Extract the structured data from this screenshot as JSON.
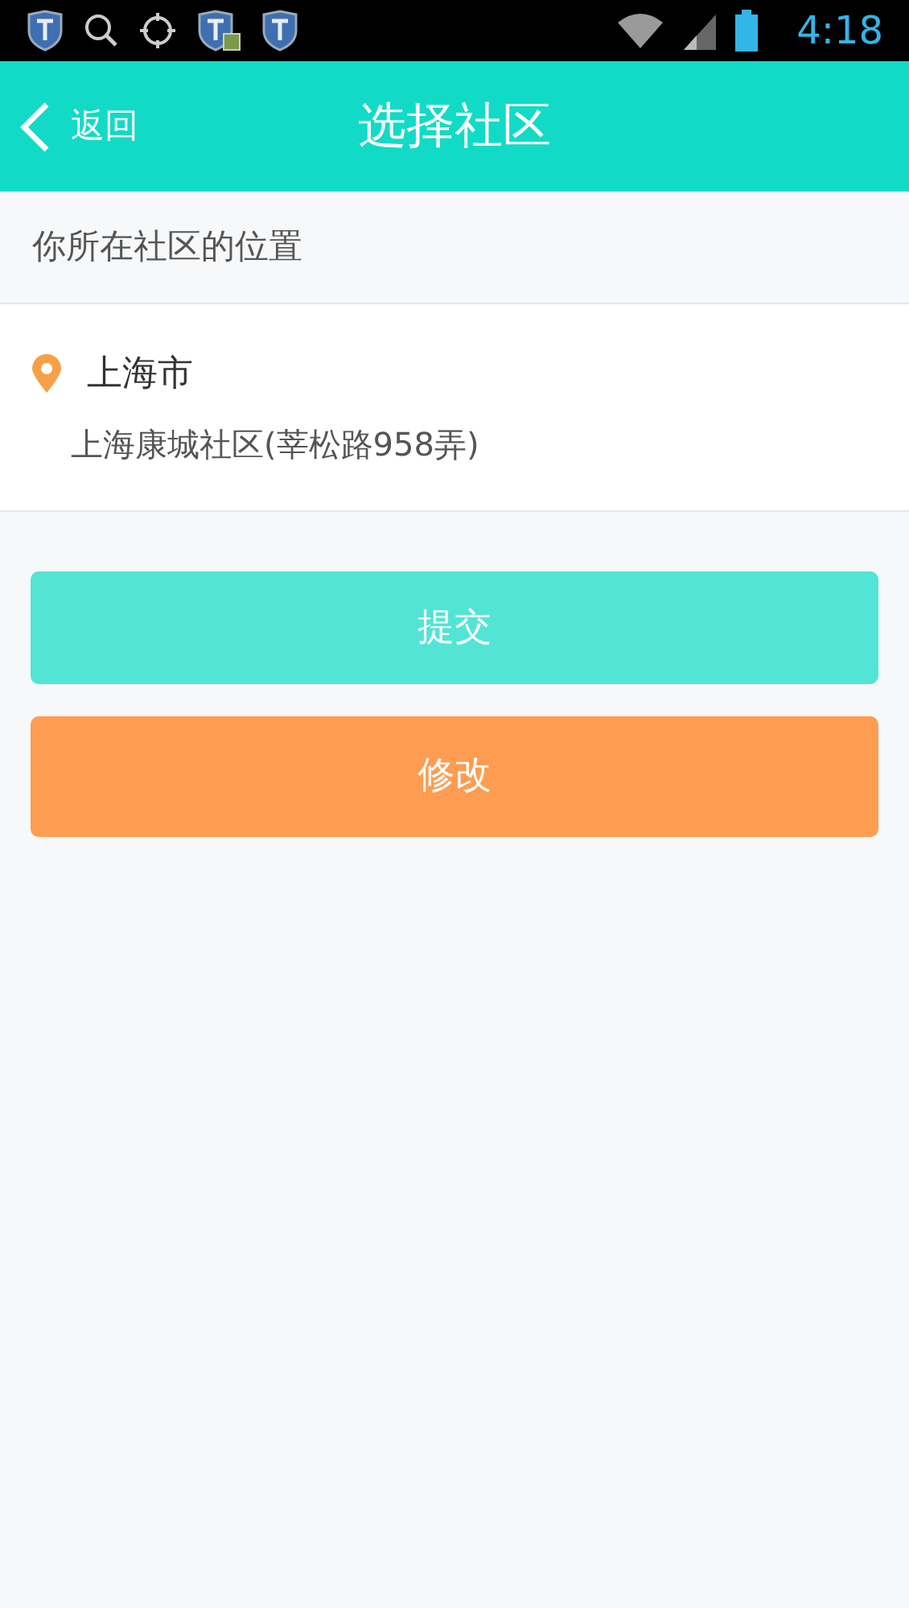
{
  "status_bar": {
    "time": "4:18"
  },
  "header": {
    "back": "返回",
    "title": "选择社区"
  },
  "section_label": "你所在社区的位置",
  "location": {
    "city": "上海市",
    "community": "上海康城社区(莘松路958弄)"
  },
  "buttons": [
    {
      "kind": "submit",
      "label": "提交"
    },
    {
      "kind": "edit",
      "label": "修改"
    }
  ]
}
